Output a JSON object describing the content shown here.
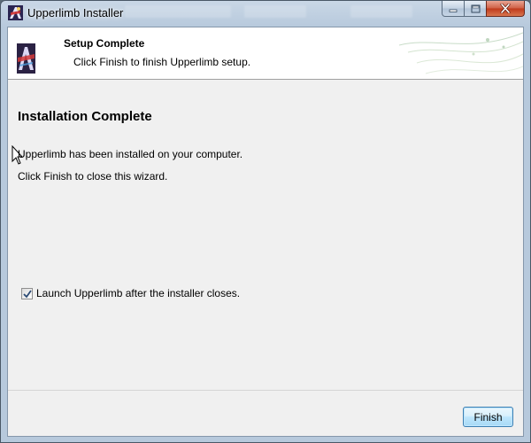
{
  "window": {
    "title": "Upperlimb Installer",
    "icon": "upperlimb-app-icon",
    "controls": [
      "minimize-icon",
      "maximize-icon",
      "close-icon"
    ]
  },
  "header": {
    "title": "Setup Complete",
    "subtitle": "Click Finish to finish Upperlimb setup.",
    "logo": "upperlimb-logo"
  },
  "body": {
    "heading": "Installation Complete",
    "message_installed": "Upperlimb has been installed on your computer.",
    "message_close": "Click Finish to close this wizard."
  },
  "options": {
    "launch_label": "Launch Upperlimb after the installer closes.",
    "launch_checked": true
  },
  "buttons": {
    "finish_label": "Finish"
  },
  "colors": {
    "accent": "#3c7fb1",
    "close_button": "#c0391b",
    "client_bg": "#f0f0f0"
  }
}
